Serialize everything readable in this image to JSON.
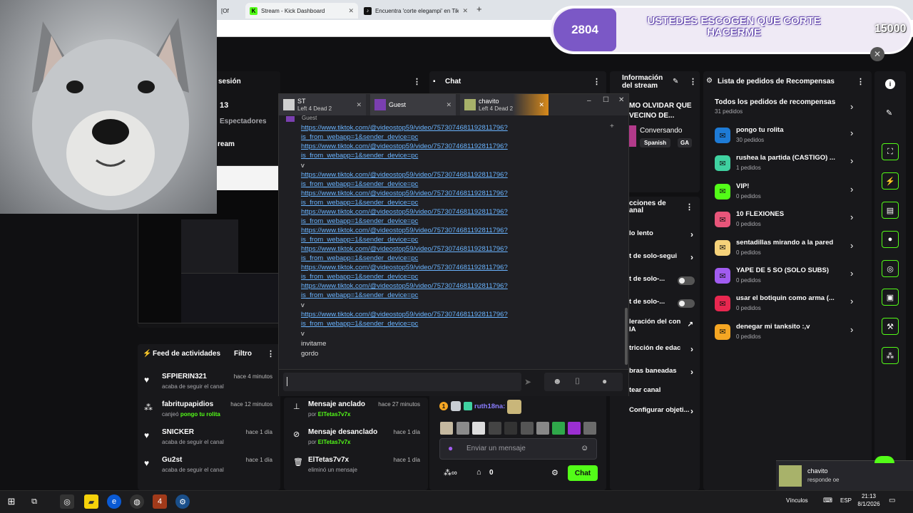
{
  "browser": {
    "tabs": [
      {
        "label": "[Of"
      },
      {
        "label": "Stream - Kick Dashboard"
      },
      {
        "label": "Encuentra 'corte elegampi' en Tik"
      }
    ],
    "new_tab": "+"
  },
  "overlay": {
    "count": "2804",
    "message": "USTEDES ESCOGEN QUE CORTE HACERME",
    "points": "15000"
  },
  "session": {
    "title": "sesión",
    "value": "13",
    "viewers_label": "Espectadores",
    "stream_label": "ream"
  },
  "chat_panel": {
    "title": "Chat"
  },
  "stream_info": {
    "title": "Información del stream",
    "stream_title": "MO OLVIDAR QUE VECINO DE...",
    "category": "Conversando",
    "tags": [
      "Spanish",
      "GA"
    ]
  },
  "quick_actions": {
    "title": "cciones de anal",
    "items": [
      {
        "label": "lo lento"
      },
      {
        "label": "t de solo-segui"
      },
      {
        "label": "t de solo-..."
      },
      {
        "label": "t de solo-..."
      },
      {
        "label": "leración del con IA"
      },
      {
        "label": "tricción de edac"
      },
      {
        "label": "bras baneadas"
      },
      {
        "label": "tear canal"
      },
      {
        "label": "Configurar objeti..."
      }
    ]
  },
  "rewards": {
    "title": "Lista de pedidos de Recompensas",
    "all_label": "Todos los pedidos de recompensas",
    "all_count": "31 pedidos",
    "items": [
      {
        "name": "pongo tu rolita",
        "count": "30 pedidos",
        "color": "#1e7bd6"
      },
      {
        "name": "rushea la partida (CASTIGO) ...",
        "count": "1 pedidos",
        "color": "#3fd1a0"
      },
      {
        "name": "VIP!",
        "count": "0 pedidos",
        "color": "#53fc18"
      },
      {
        "name": "10 FLEXIONES",
        "count": "0 pedidos",
        "color": "#e8557a"
      },
      {
        "name": "sentadillas mirando a la pared",
        "count": "0 pedidos",
        "color": "#f5d27a"
      },
      {
        "name": "YAPE DE 5 SO (SOLO SUBS)",
        "count": "0 pedidos",
        "color": "#a15cf0"
      },
      {
        "name": "usar el botiquin como arma (...",
        "count": "0 pedidos",
        "color": "#e8274f"
      },
      {
        "name": "denegar mi tanksito :,v",
        "count": "0 pedidos",
        "color": "#f5a623"
      }
    ]
  },
  "activity": {
    "title": "Feed de actividades",
    "filter": "Filtro",
    "items": [
      {
        "name": "SFPIERIN321",
        "time": "hace 4 minutos",
        "desc": "acaba de seguir el canal",
        "highlight": ""
      },
      {
        "name": "fabritupapidios",
        "time": "hace 12 minutos",
        "desc": "canjeó",
        "highlight": "pongo tu rolita"
      },
      {
        "name": "SNICKER",
        "time": "hace 1 día",
        "desc": "acaba de seguir el canal",
        "highlight": ""
      },
      {
        "name": "Gu2st",
        "time": "hace 1 día",
        "desc": "acaba de seguir el canal",
        "highlight": ""
      }
    ]
  },
  "mod_log": {
    "items": [
      {
        "action": "Mensaje anclado",
        "time": "hace 27 minutos",
        "by": "por",
        "user": "ElTetas7v7x"
      },
      {
        "action": "Mensaje desanclado",
        "time": "hace 1 día",
        "by": "por",
        "user": "ElTetas7v7x"
      },
      {
        "action": "ElTetas7v7x",
        "time": "hace 1 día",
        "by": "eliminó un mensaje",
        "user": ""
      }
    ]
  },
  "kick_chat": {
    "user": "ruth18na:",
    "placeholder": "Enviar un mensaje",
    "count": "0",
    "send": "Chat"
  },
  "chat_window": {
    "tabs": [
      {
        "name": "ST",
        "game": "Left 4 Dead 2"
      },
      {
        "name": "Guest",
        "game": ""
      },
      {
        "name": "chavito",
        "game": "Left 4 Dead 2"
      }
    ],
    "partial_top": "Guest",
    "messages": [
      {
        "type": "link",
        "line1": "https://www.tiktok.com/@videostop59/video/7573074681192811796?",
        "line2": "is_from_webapp=1&sender_device=pc"
      },
      {
        "type": "link",
        "line1": "https://www.tiktok.com/@videostop59/video/7573074681192811796?",
        "line2": "is_from_webapp=1&sender_device=pc"
      },
      {
        "type": "text",
        "text": "v"
      },
      {
        "type": "link",
        "line1": "https://www.tiktok.com/@videostop59/video/7573074681192811796?",
        "line2": "is_from_webapp=1&sender_device=pc"
      },
      {
        "type": "link",
        "line1": "https://www.tiktok.com/@videostop59/video/7573074681192811796?",
        "line2": "is_from_webapp=1&sender_device=pc"
      },
      {
        "type": "link",
        "line1": "https://www.tiktok.com/@videostop59/video/7573074681192811796?",
        "line2": "is_from_webapp=1&sender_device=pc"
      },
      {
        "type": "link",
        "line1": "https://www.tiktok.com/@videostop59/video/7573074681192811796?",
        "line2": "is_from_webapp=1&sender_device=pc"
      },
      {
        "type": "link",
        "line1": "https://www.tiktok.com/@videostop59/video/7573074681192811796?",
        "line2": "is_from_webapp=1&sender_device=pc"
      },
      {
        "type": "link",
        "line1": "https://www.tiktok.com/@videostop59/video/7573074681192811796?",
        "line2": "is_from_webapp=1&sender_device=pc"
      },
      {
        "type": "link",
        "line1": "https://www.tiktok.com/@videostop59/video/7573074681192811796?",
        "line2": "is_from_webapp=1&sender_device=pc"
      },
      {
        "type": "text",
        "text": "v"
      },
      {
        "type": "link",
        "line1": "https://www.tiktok.com/@videostop59/video/7573074681192811796?",
        "line2": "is_from_webapp=1&sender_device=pc"
      },
      {
        "type": "text",
        "text": "v"
      },
      {
        "type": "text",
        "text": "invitame"
      },
      {
        "type": "text",
        "text": "gordo"
      }
    ]
  },
  "notification": {
    "name": "chavito",
    "text": "responde oe"
  },
  "taskbar": {
    "links": "Vínculos",
    "lang": "ESP",
    "time": "21:13",
    "date": "8/1/2026"
  }
}
